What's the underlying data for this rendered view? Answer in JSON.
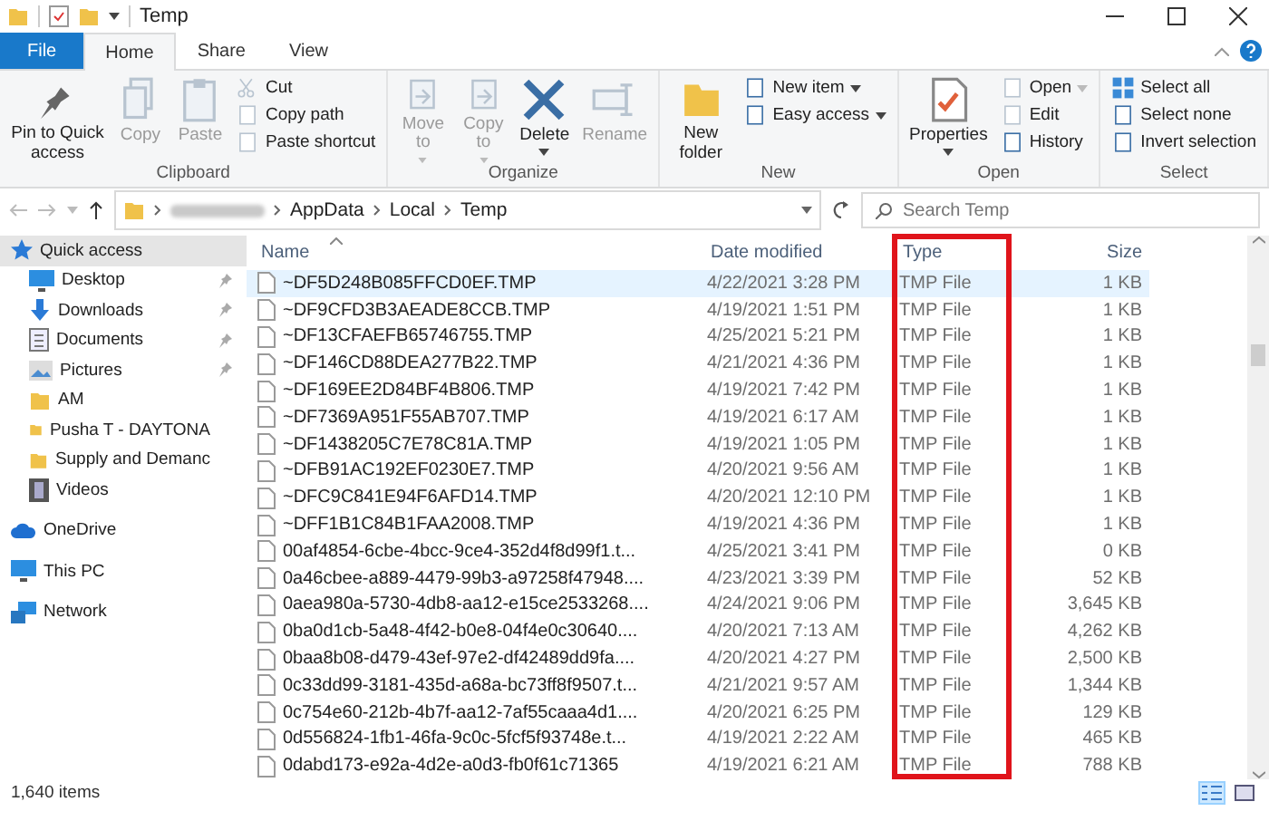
{
  "window": {
    "title": "Temp"
  },
  "tabs": [
    {
      "label": "File",
      "kind": "file",
      "selected": false
    },
    {
      "label": "Home",
      "kind": "tab",
      "selected": true
    },
    {
      "label": "Share",
      "kind": "tab",
      "selected": false
    },
    {
      "label": "View",
      "kind": "tab",
      "selected": false
    }
  ],
  "ribbon": {
    "groups": [
      {
        "label": "Clipboard",
        "items": [
          {
            "kind": "large",
            "label": "Pin to Quick access",
            "disabled": false,
            "dropdown": false
          },
          {
            "kind": "large",
            "label": "Copy",
            "disabled": true,
            "dropdown": false
          },
          {
            "kind": "large",
            "label": "Paste",
            "disabled": true,
            "dropdown": false
          },
          {
            "kind": "stack",
            "items": [
              {
                "label": "Cut",
                "disabled": true,
                "dropdown": false
              },
              {
                "label": "Copy path",
                "disabled": true,
                "dropdown": false
              },
              {
                "label": "Paste shortcut",
                "disabled": true,
                "dropdown": false
              }
            ]
          }
        ]
      },
      {
        "label": "Organize",
        "items": [
          {
            "kind": "large",
            "label": "Move to",
            "disabled": true,
            "dropdown": true
          },
          {
            "kind": "large",
            "label": "Copy to",
            "disabled": true,
            "dropdown": true
          },
          {
            "kind": "large",
            "label": "Delete",
            "disabled": false,
            "dropdown": true
          },
          {
            "kind": "large",
            "label": "Rename",
            "disabled": true,
            "dropdown": false
          }
        ]
      },
      {
        "label": "New",
        "items": [
          {
            "kind": "large",
            "label": "New folder",
            "disabled": false,
            "dropdown": false
          },
          {
            "kind": "stack",
            "items": [
              {
                "label": "New item",
                "disabled": false,
                "dropdown": true
              },
              {
                "label": "Easy access",
                "disabled": false,
                "dropdown": true
              }
            ]
          }
        ]
      },
      {
        "label": "Open",
        "items": [
          {
            "kind": "large",
            "label": "Properties",
            "disabled": false,
            "dropdown": true
          },
          {
            "kind": "stack",
            "items": [
              {
                "label": "Open",
                "disabled": true,
                "dropdown": true
              },
              {
                "label": "Edit",
                "disabled": true,
                "dropdown": false
              },
              {
                "label": "History",
                "disabled": false,
                "dropdown": false
              }
            ]
          }
        ]
      },
      {
        "label": "Select",
        "items": [
          {
            "kind": "stack",
            "items": [
              {
                "label": "Select all",
                "disabled": false,
                "dropdown": false
              },
              {
                "label": "Select none",
                "disabled": false,
                "dropdown": false
              },
              {
                "label": "Invert selection",
                "disabled": false,
                "dropdown": false
              }
            ]
          }
        ]
      }
    ]
  },
  "address_bar": {
    "crumbs": [
      "AppData",
      "Local",
      "Temp"
    ],
    "back_disabled": true,
    "forward_disabled": true
  },
  "search": {
    "placeholder": "Search Temp"
  },
  "sidebar": {
    "items": [
      {
        "label": "Quick access",
        "selected": true,
        "children": [
          {
            "label": "Desktop",
            "selected": false,
            "pinned": true
          },
          {
            "label": "Downloads",
            "selected": false,
            "pinned": true
          },
          {
            "label": "Documents",
            "selected": false,
            "pinned": true
          },
          {
            "label": "Pictures",
            "selected": false,
            "pinned": true
          },
          {
            "label": "AM",
            "selected": false,
            "pinned": false
          },
          {
            "label": "Pusha T - DAYTONA",
            "selected": false,
            "pinned": false
          },
          {
            "label": "Supply and Demanc",
            "selected": false,
            "pinned": false
          },
          {
            "label": "Videos",
            "selected": false,
            "pinned": false
          }
        ]
      },
      {
        "label": "OneDrive",
        "selected": false
      },
      {
        "label": "This PC",
        "selected": false
      },
      {
        "label": "Network",
        "selected": false
      }
    ]
  },
  "table": {
    "columns": [
      {
        "label": "Name",
        "sorted": true,
        "highlighted": false
      },
      {
        "label": "Date modified",
        "sorted": false,
        "highlighted": false
      },
      {
        "label": "Type",
        "sorted": false,
        "highlighted": true
      },
      {
        "label": "Size",
        "sorted": false,
        "highlighted": false
      }
    ],
    "rows": [
      {
        "name": "~DF5D248B085FFCD0EF.TMP",
        "date": "4/22/2021 3:28 PM",
        "type": "TMP File",
        "size": "1 KB",
        "selected": true
      },
      {
        "name": "~DF9CFD3B3AEADE8CCB.TMP",
        "date": "4/19/2021 1:51 PM",
        "type": "TMP File",
        "size": "1 KB",
        "selected": false
      },
      {
        "name": "~DF13CFAEFB65746755.TMP",
        "date": "4/25/2021 5:21 PM",
        "type": "TMP File",
        "size": "1 KB",
        "selected": false
      },
      {
        "name": "~DF146CD88DEA277B22.TMP",
        "date": "4/21/2021 4:36 PM",
        "type": "TMP File",
        "size": "1 KB",
        "selected": false
      },
      {
        "name": "~DF169EE2D84BF4B806.TMP",
        "date": "4/19/2021 7:42 PM",
        "type": "TMP File",
        "size": "1 KB",
        "selected": false
      },
      {
        "name": "~DF7369A951F55AB707.TMP",
        "date": "4/19/2021 6:17 AM",
        "type": "TMP File",
        "size": "1 KB",
        "selected": false
      },
      {
        "name": "~DF1438205C7E78C81A.TMP",
        "date": "4/19/2021 1:05 PM",
        "type": "TMP File",
        "size": "1 KB",
        "selected": false
      },
      {
        "name": "~DFB91AC192EF0230E7.TMP",
        "date": "4/20/2021 9:56 AM",
        "type": "TMP File",
        "size": "1 KB",
        "selected": false
      },
      {
        "name": "~DFC9C841E94F6AFD14.TMP",
        "date": "4/20/2021 12:10 PM",
        "type": "TMP File",
        "size": "1 KB",
        "selected": false
      },
      {
        "name": "~DFF1B1C84B1FAA2008.TMP",
        "date": "4/19/2021 4:36 PM",
        "type": "TMP File",
        "size": "1 KB",
        "selected": false
      },
      {
        "name": "00af4854-6cbe-4bcc-9ce4-352d4f8d99f1.t...",
        "date": "4/25/2021 3:41 PM",
        "type": "TMP File",
        "size": "0 KB",
        "selected": false
      },
      {
        "name": "0a46cbee-a889-4479-99b3-a97258f47948....",
        "date": "4/23/2021 3:39 PM",
        "type": "TMP File",
        "size": "52 KB",
        "selected": false
      },
      {
        "name": "0aea980a-5730-4db8-aa12-e15ce2533268....",
        "date": "4/24/2021 9:06 PM",
        "type": "TMP File",
        "size": "3,645 KB",
        "selected": false
      },
      {
        "name": "0ba0d1cb-5a48-4f42-b0e8-04f4e0c30640....",
        "date": "4/20/2021 7:13 AM",
        "type": "TMP File",
        "size": "4,262 KB",
        "selected": false
      },
      {
        "name": "0baa8b08-d479-43ef-97e2-df42489dd9fa....",
        "date": "4/20/2021 4:27 PM",
        "type": "TMP File",
        "size": "2,500 KB",
        "selected": false
      },
      {
        "name": "0c33dd99-3181-435d-a68a-bc73ff8f9507.t...",
        "date": "4/21/2021 9:57 AM",
        "type": "TMP File",
        "size": "1,344 KB",
        "selected": false
      },
      {
        "name": "0c754e60-212b-4b7f-aa12-7af55caaa4d1....",
        "date": "4/20/2021 6:25 PM",
        "type": "TMP File",
        "size": "129 KB",
        "selected": false
      },
      {
        "name": "0d556824-1fb1-46fa-9c0c-5fcf5f93748e.t...",
        "date": "4/19/2021 2:22 AM",
        "type": "TMP File",
        "size": "465 KB",
        "selected": false
      },
      {
        "name": "0dabd173-e92a-4d2e-a0d3-fb0f61c71365",
        "date": "4/19/2021 6:21 AM",
        "type": "TMP File",
        "size": "788 KB",
        "selected": false
      }
    ]
  },
  "status_bar": {
    "item_count": "1,640 items"
  },
  "view_buttons": [
    {
      "kind": "details",
      "selected": true
    },
    {
      "kind": "large_icons",
      "selected": false
    }
  ]
}
